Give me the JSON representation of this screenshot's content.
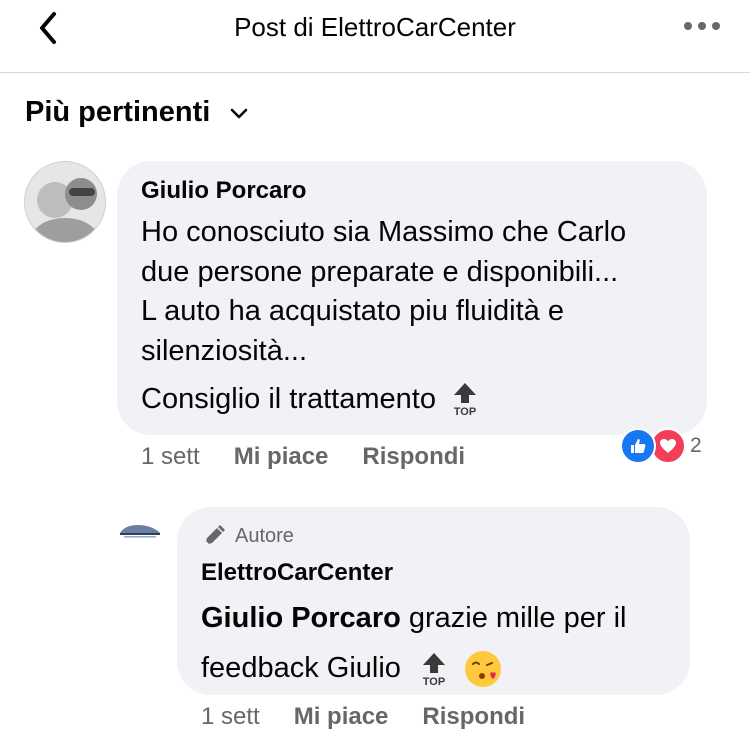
{
  "header": {
    "title": "Post di ElettroCarCenter"
  },
  "sort": {
    "label": "Più pertinenti"
  },
  "comment": {
    "author": "Giulio Porcaro",
    "lines": [
      "Ho conosciuto sia Massimo che Carlo",
      "due persone preparate e disponibili...",
      "L auto ha acquistato piu fluidità e",
      "silenziosità..."
    ],
    "recommend": "Consiglio il trattamento",
    "time": "1 sett",
    "like_label": "Mi piace",
    "reply_label": "Rispondi",
    "reaction_count": "2"
  },
  "reply": {
    "badge": "Autore",
    "author": "ElettroCarCenter",
    "mention": "Giulio Porcaro",
    "text_a": " grazie mille per il",
    "text_b": "feedback Giulio",
    "time": "1 sett",
    "like_label": "Mi piace",
    "reply_label": "Rispondi"
  },
  "icons": {
    "back": "chevron-left-icon",
    "more": "more-dots-icon",
    "sort": "chevron-down-icon",
    "top": "top-arrow-emoji",
    "kiss": "kissing-face-emoji",
    "like": "like-reaction-icon",
    "love": "love-reaction-icon",
    "author": "pen-icon"
  },
  "colors": {
    "accent_blue": "#1877f2",
    "love_red": "#f33e58",
    "bubble": "#f0f2f5",
    "muted_text": "#65676b"
  }
}
